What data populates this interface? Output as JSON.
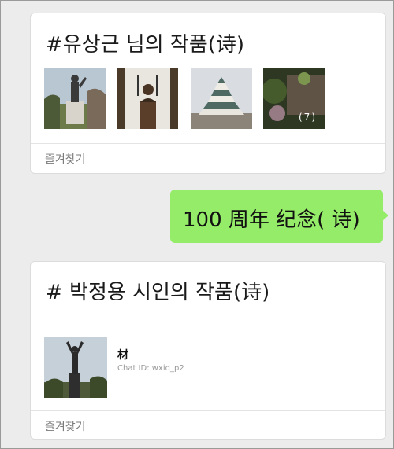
{
  "card1": {
    "title": "#유상근 님의 작품(诗)",
    "images": [
      {
        "icon": "statue-photo"
      },
      {
        "icon": "bust-photo"
      },
      {
        "icon": "castle-photo"
      },
      {
        "icon": "garden-photo",
        "count_label": "(7)"
      }
    ],
    "footer_label": "즐겨찾기"
  },
  "bubble": {
    "text": "100 周年 纪念(  诗)",
    "color": "#95ec69"
  },
  "card2": {
    "title": "# 박정용 시인의 작품(诗)",
    "contact": {
      "icon": "statue-photo",
      "name": "材",
      "id_label": "Chat ID: wxid_p2"
    },
    "footer_label": "즐겨찾기"
  }
}
